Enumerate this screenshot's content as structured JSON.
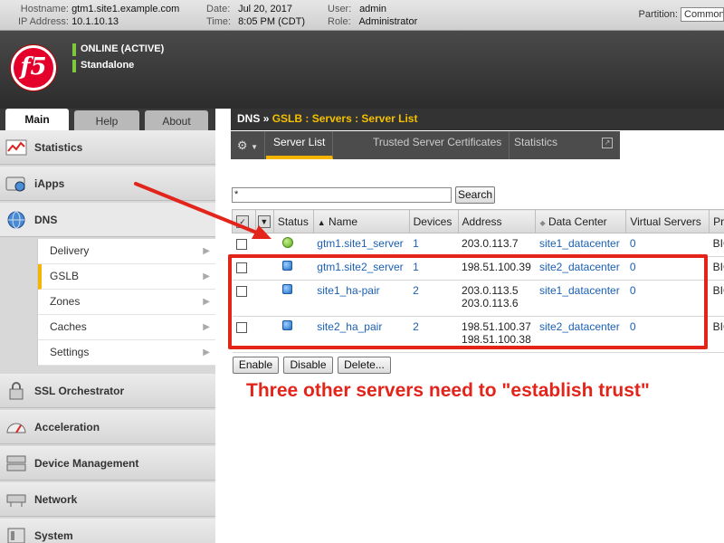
{
  "topbar": {
    "hostname_label": "Hostname:",
    "hostname": "gtm1.site1.example.com",
    "ip_label": "IP Address:",
    "ip": "10.1.10.13",
    "date_label": "Date:",
    "date": "Jul 20, 2017",
    "time_label": "Time:",
    "time": "8:05 PM (CDT)",
    "user_label": "User:",
    "user": "admin",
    "role_label": "Role:",
    "role": "Administrator",
    "partition_label": "Partition:",
    "partition_value": "Common"
  },
  "header": {
    "logo": "f5",
    "status": "ONLINE (ACTIVE)",
    "mode": "Standalone"
  },
  "left_tabs": {
    "main": "Main",
    "help": "Help",
    "about": "About"
  },
  "nav": {
    "statistics": "Statistics",
    "iapps": "iApps",
    "dns": "DNS",
    "dns_sub": [
      "Delivery",
      "GSLB",
      "Zones",
      "Caches",
      "Settings"
    ],
    "ssl": "SSL Orchestrator",
    "acceleration": "Acceleration",
    "device_mgmt": "Device Management",
    "network": "Network",
    "system": "System"
  },
  "breadcrumb": {
    "root": "DNS",
    "sep": "»",
    "path": "GSLB : Servers : Server List"
  },
  "subtabs": {
    "server_list": "Server List",
    "trusted": "Trusted Server Certificates",
    "statistics": "Statistics"
  },
  "search": {
    "value": "*",
    "button": "Search"
  },
  "table": {
    "headers": {
      "status": "Status",
      "name": "Name",
      "devices": "Devices",
      "address": "Address",
      "datacenter": "Data Center",
      "virtual_servers": "Virtual Servers",
      "product": "Pro"
    },
    "rows": [
      {
        "name": "gtm1.site1_server",
        "devices": "1",
        "addr1": "203.0.113.7",
        "addr2": "",
        "dc": "site1_datacenter",
        "vs": "0",
        "product": "BIG",
        "status": "green"
      },
      {
        "name": "gtm1.site2_server",
        "devices": "1",
        "addr1": "198.51.100.39",
        "addr2": "",
        "dc": "site2_datacenter",
        "vs": "0",
        "product": "BIG",
        "status": "blue"
      },
      {
        "name": "site1_ha-pair",
        "devices": "2",
        "addr1": "203.0.113.5",
        "addr2": "203.0.113.6",
        "dc": "site1_datacenter",
        "vs": "0",
        "product": "BIG",
        "status": "blue"
      },
      {
        "name": "site2_ha_pair",
        "devices": "2",
        "addr1": "198.51.100.37",
        "addr2": "198.51.100.38",
        "dc": "site2_datacenter",
        "vs": "0",
        "product": "BIG",
        "status": "blue"
      }
    ]
  },
  "actions": {
    "enable": "Enable",
    "disable": "Disable",
    "delete": "Delete..."
  },
  "annotation": {
    "callout": "Three other servers need to \"establish trust\"",
    "color": "#e3241b"
  }
}
